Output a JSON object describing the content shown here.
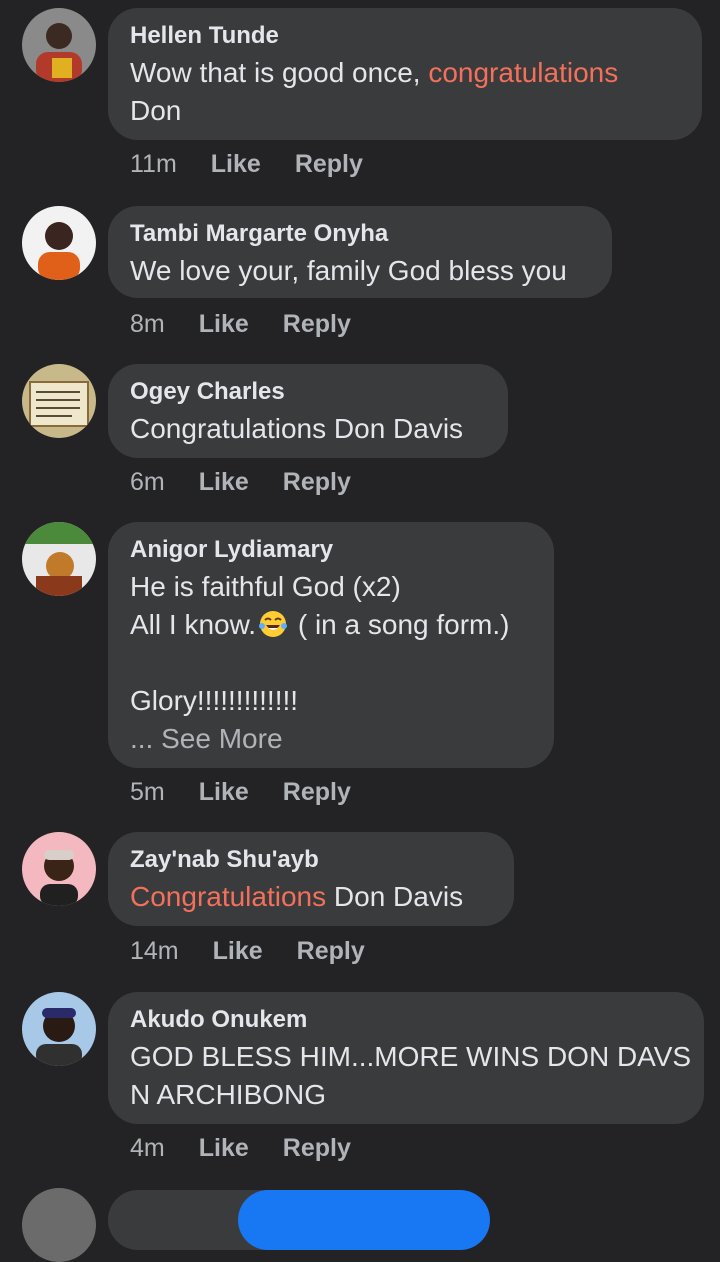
{
  "comments": [
    {
      "author": "Hellen Tunde",
      "line1_pre": "Wow that is good once, ",
      "line1_hl": "congratulations",
      "line2": "Don",
      "time": "11m",
      "like": "Like",
      "reply": "Reply"
    },
    {
      "author": "Tambi Margarte Onyha",
      "line1": "We love your, family God bless you",
      "time": "8m",
      "like": "Like",
      "reply": "Reply"
    },
    {
      "author": "Ogey Charles",
      "line1": "Congratulations Don Davis",
      "time": "6m",
      "like": "Like",
      "reply": "Reply"
    },
    {
      "author": "Anigor Lydiamary",
      "line1": "He is faithful God (x2)",
      "line2_pre": "All I know.",
      "line2_post": " ( in a song form.)",
      "line3": "Glory!!!!!!!!!!!!!",
      "see_more": "... See More",
      "time": "5m",
      "like": "Like",
      "reply": "Reply"
    },
    {
      "author": "Zay'nab Shu'ayb",
      "line1_hl": "Congratulations",
      "line1_post": " Don Davis",
      "time": "14m",
      "like": "Like",
      "reply": "Reply"
    },
    {
      "author": "Akudo Onukem",
      "line1": "GOD BLESS HIM...MORE WINS DON DAVS",
      "line2": "N ARCHIBONG",
      "time": "4m",
      "like": "Like",
      "reply": "Reply"
    }
  ],
  "icons": {
    "emoji": "tears-of-joy-emoji"
  },
  "colors": {
    "background": "#232325",
    "bubble": "#3a3b3c",
    "highlight": "#f3705a",
    "secondary_text": "#b0b3b8",
    "accent": "#1877f2"
  }
}
